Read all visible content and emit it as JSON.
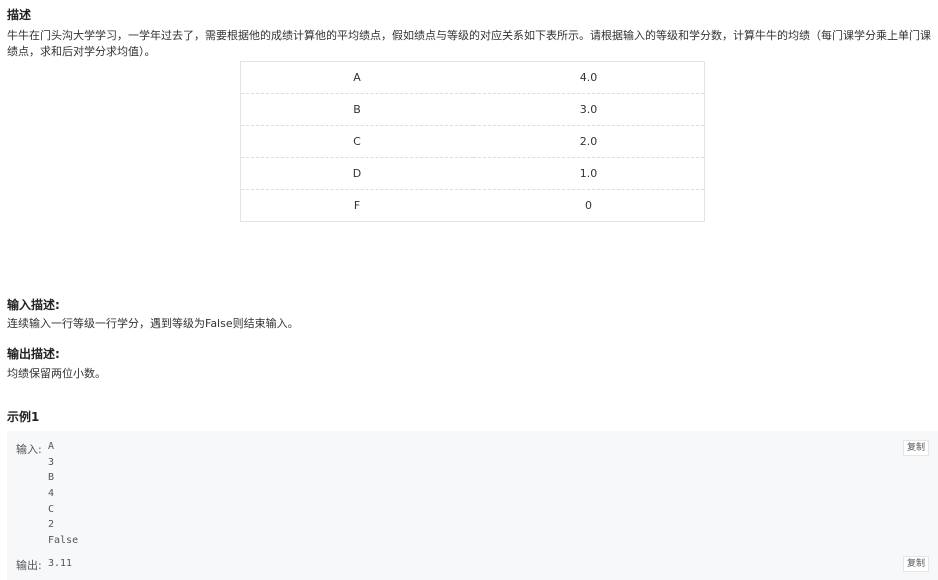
{
  "description": {
    "title": "描述",
    "text": "牛牛在门头沟大学学习，一学年过去了，需要根据他的成绩计算他的平均绩点，假如绩点与等级的对应关系如下表所示。请根据输入的等级和学分数，计算牛牛的均绩（每门课学分乘上单门课绩点，求和后对学分求均值）。",
    "table": [
      {
        "grade": "A",
        "point": "4.0"
      },
      {
        "grade": "B",
        "point": "3.0"
      },
      {
        "grade": "C",
        "point": "2.0"
      },
      {
        "grade": "D",
        "point": "1.0"
      },
      {
        "grade": "F",
        "point": "0"
      }
    ]
  },
  "input_desc": {
    "title": "输入描述:",
    "text": "连续输入一行等级一行学分，遇到等级为False则结束输入。"
  },
  "output_desc": {
    "title": "输出描述:",
    "text": "均绩保留两位小数。"
  },
  "example": {
    "title": "示例1",
    "input_label": "输入:",
    "input_lines": [
      "A",
      "3",
      "B",
      "4",
      "C",
      "2",
      "False"
    ],
    "output_label": "输出:",
    "output_value": "3.11",
    "copy_label": "复制"
  }
}
